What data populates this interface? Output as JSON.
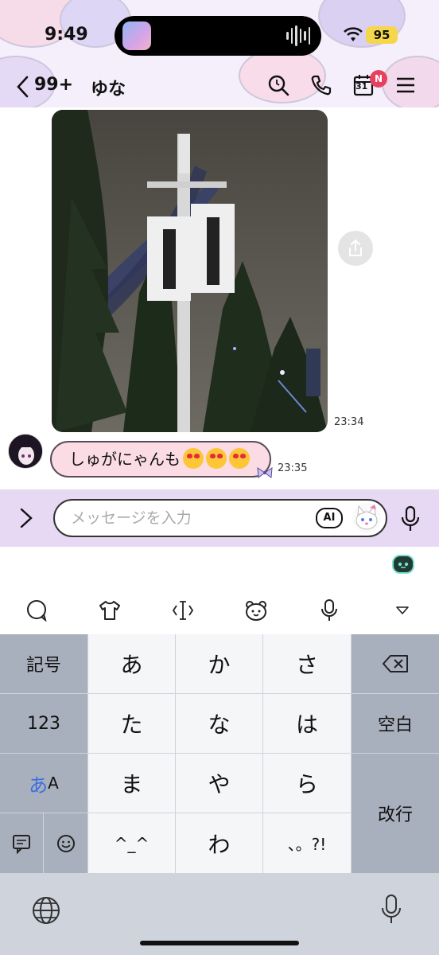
{
  "status_bar": {
    "time": "9:49",
    "battery": "95"
  },
  "nav": {
    "unread_count": "99+",
    "chat_name": "ゆな",
    "calendar_day": "31",
    "calendar_badge": "N"
  },
  "messages": [
    {
      "type": "image",
      "sender": "self",
      "time": "23:34"
    },
    {
      "type": "text",
      "sender": "other",
      "text": "しゅがにゃんも",
      "emoji_count": 3,
      "time": "23:35"
    }
  ],
  "input": {
    "placeholder": "メッセージを入力",
    "ai_label": "AI"
  },
  "toolbar_icons": [
    "chat-bubble-icon",
    "tshirt-icon",
    "text-cursor-icon",
    "bear-face-icon",
    "microphone-icon",
    "collapse-triangle-icon"
  ],
  "keyboard": {
    "left_keys": [
      "記号",
      "123",
      "あA"
    ],
    "rows": [
      [
        "あ",
        "か",
        "さ"
      ],
      [
        "た",
        "な",
        "は"
      ],
      [
        "ま",
        "や",
        "ら"
      ],
      [
        "^_^",
        "わ",
        "、。?!"
      ]
    ],
    "right_keys": {
      "space": "空白",
      "return": "改行"
    }
  },
  "colors": {
    "accent": "#e7d8f4",
    "bubble": "#fbdbe4",
    "badge": "#e8415f",
    "battery": "#f6d64a"
  }
}
